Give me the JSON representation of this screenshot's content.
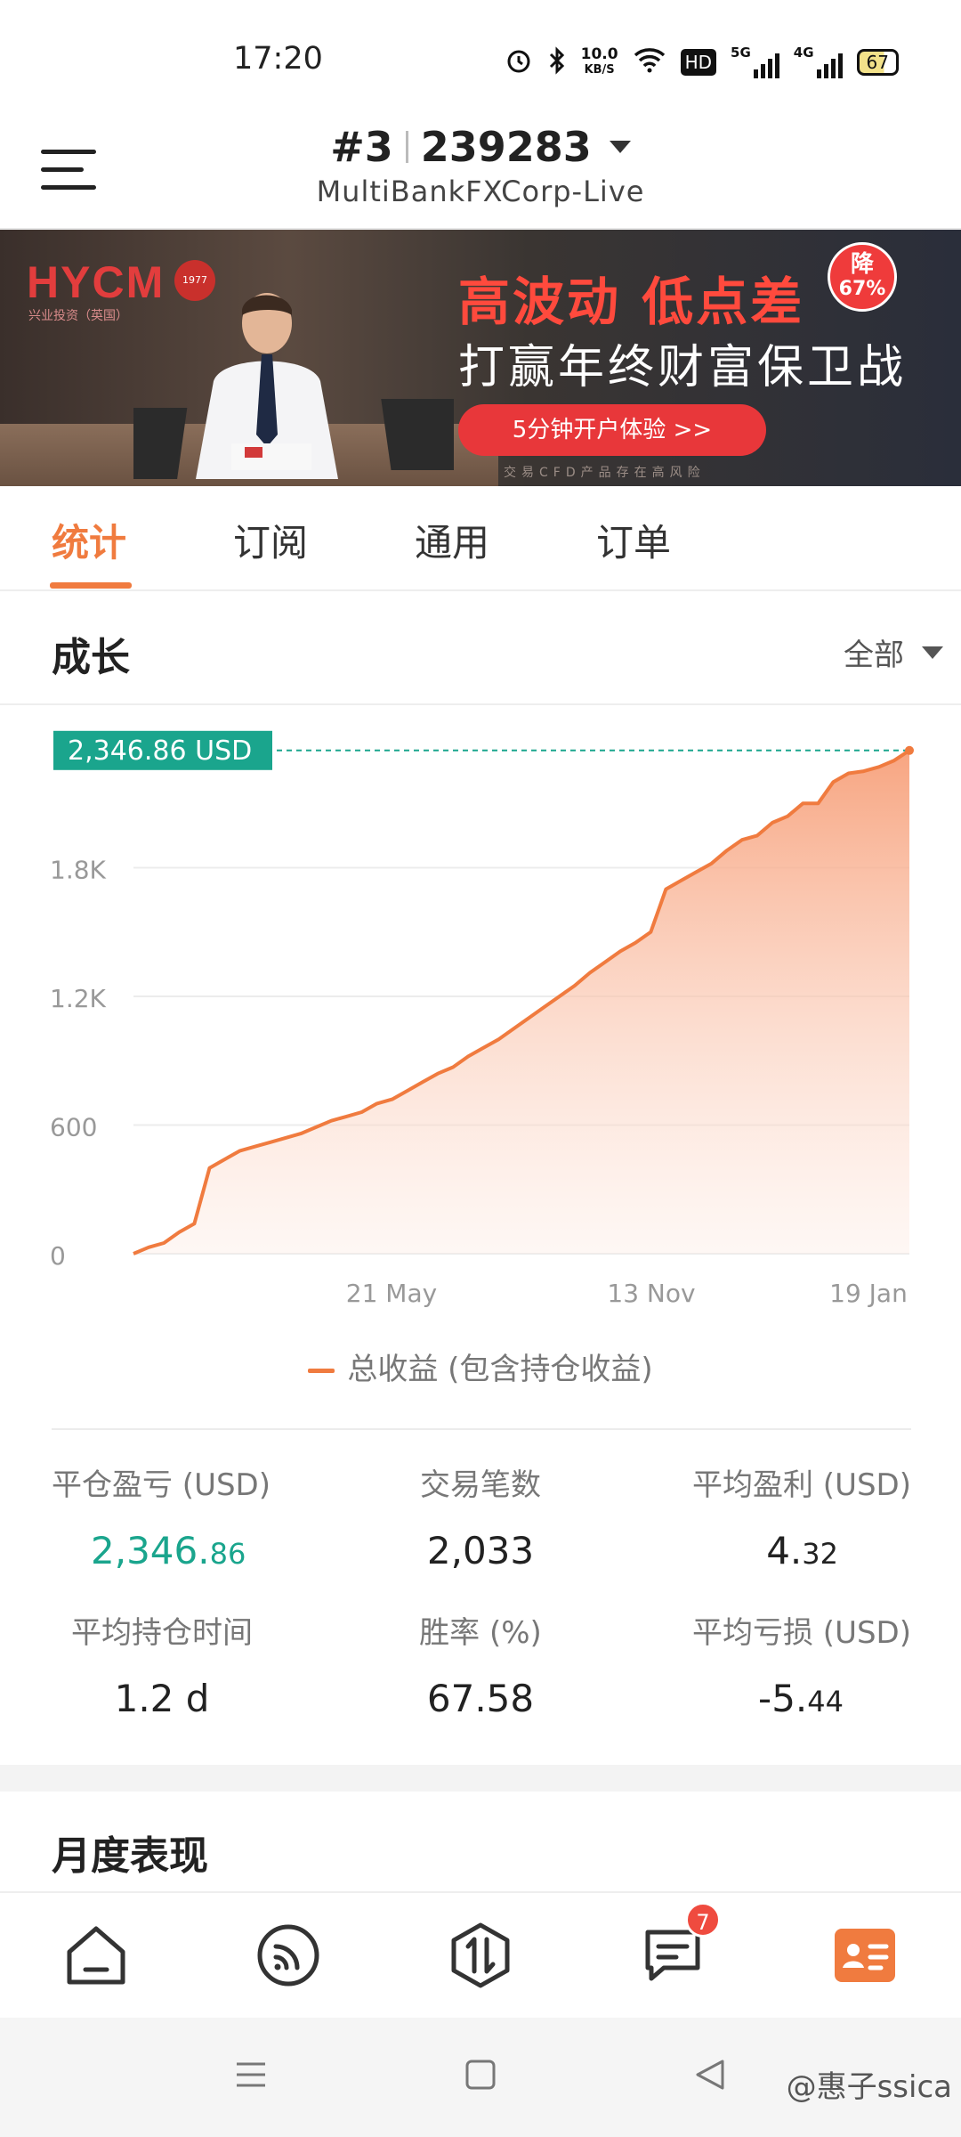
{
  "status_bar": {
    "time": "17:20",
    "net_speed_top": "10.0",
    "net_speed_bottom": "KB/S",
    "hd_label": "HD",
    "signal_1": "5G",
    "signal_2": "4G",
    "battery": "67"
  },
  "header": {
    "account_prefix": "#3",
    "account_number": "239283",
    "server": "MultiBankFXCorp-Live"
  },
  "banner": {
    "logo": "HYCM",
    "logo_sub": "兴业投资（英国）",
    "seal": "1977",
    "headline": "高波动 低点差",
    "subline": "打赢年终财富保卫战",
    "badge_top": "降",
    "badge_bottom": "67%",
    "cta": "5分钟开户体验 >>",
    "risk_note": "交易CFD产品存在高风险"
  },
  "tabs": [
    {
      "label": "统计"
    },
    {
      "label": "订阅"
    },
    {
      "label": "通用"
    },
    {
      "label": "订单"
    }
  ],
  "growth": {
    "title": "成长",
    "filter_label": "全部"
  },
  "chart_data": {
    "type": "area",
    "title": "",
    "xlabel": "",
    "ylabel": "",
    "ylim": [
      0,
      2400
    ],
    "y_ticks": [
      "0",
      "600",
      "1.2K",
      "1.8K"
    ],
    "x_ticks": [
      "21 May",
      "13 Nov",
      "19 Jan"
    ],
    "current_value_label": "2,346.86 USD",
    "series": [
      {
        "name": "总收益 (包含持仓收益)",
        "color": "#f07b3f",
        "values": [
          0,
          30,
          50,
          100,
          140,
          400,
          440,
          480,
          500,
          520,
          540,
          560,
          590,
          620,
          640,
          660,
          700,
          720,
          760,
          800,
          840,
          870,
          920,
          960,
          1000,
          1050,
          1100,
          1150,
          1200,
          1250,
          1310,
          1360,
          1410,
          1450,
          1500,
          1700,
          1740,
          1780,
          1820,
          1880,
          1930,
          1950,
          2010,
          2040,
          2100,
          2100,
          2200,
          2240,
          2250,
          2270,
          2300,
          2346.86
        ]
      }
    ],
    "legend": "总收益 (包含持仓收益)"
  },
  "stats": {
    "closed_pnl_label": "平仓盈亏 (USD)",
    "closed_pnl_int": "2,346.",
    "closed_pnl_dec": "86",
    "trades_label": "交易笔数",
    "trades_value": "2,033",
    "avg_profit_label": "平均盈利 (USD)",
    "avg_profit_int": "4.",
    "avg_profit_dec": "32",
    "avg_hold_label": "平均持仓时间",
    "avg_hold_value": "1.2 d",
    "win_rate_label": "胜率 (%)",
    "win_rate_value": "67.58",
    "avg_loss_label": "平均亏损 (USD)",
    "avg_loss_int": "-5.",
    "avg_loss_dec": "44"
  },
  "monthly": {
    "title": "月度表现"
  },
  "bottom_nav": {
    "messages_badge": "7"
  },
  "watermark": "@惠子ssica",
  "colors": {
    "accent": "#f07b3f",
    "positive": "#1aa58d",
    "badge": "#ef4b3f"
  }
}
